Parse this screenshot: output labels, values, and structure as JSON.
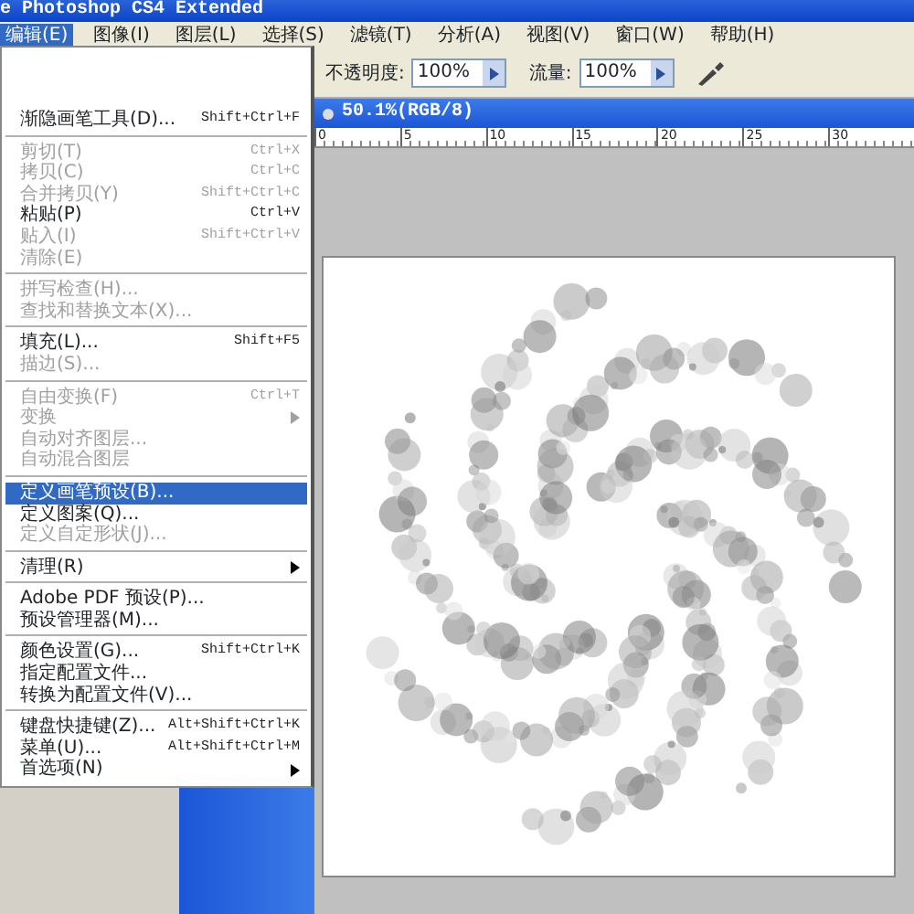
{
  "window": {
    "title": "e Photoshop CS4 Extended"
  },
  "menu_bar": [
    {
      "label": "编辑(E)",
      "selected": true
    },
    {
      "label": "图像(I)",
      "selected": false
    },
    {
      "label": "图层(L)",
      "selected": false
    },
    {
      "label": "选择(S)",
      "selected": false
    },
    {
      "label": "滤镜(T)",
      "selected": false
    },
    {
      "label": "分析(A)",
      "selected": false
    },
    {
      "label": "视图(V)",
      "selected": false
    },
    {
      "label": "窗口(W)",
      "selected": false
    },
    {
      "label": "帮助(H)",
      "selected": false
    }
  ],
  "options_bar": {
    "opacity_label": "不透明度:",
    "opacity_value": "100%",
    "flow_label": "流量:",
    "flow_value": "100%"
  },
  "edit_menu": [
    {
      "kind": "item",
      "label": "渐隐画笔工具(D)...",
      "shortcut": "Shift+Ctrl+F",
      "disabled": false,
      "selected": false
    },
    {
      "kind": "separator"
    },
    {
      "kind": "item",
      "label": "剪切(T)",
      "shortcut": "Ctrl+X",
      "disabled": true,
      "selected": false
    },
    {
      "kind": "item",
      "label": "拷贝(C)",
      "shortcut": "Ctrl+C",
      "disabled": true,
      "selected": false
    },
    {
      "kind": "item",
      "label": "合并拷贝(Y)",
      "shortcut": "Shift+Ctrl+C",
      "disabled": true,
      "selected": false
    },
    {
      "kind": "item",
      "label": "粘贴(P)",
      "shortcut": "Ctrl+V",
      "disabled": false,
      "selected": false
    },
    {
      "kind": "item",
      "label": "贴入(I)",
      "shortcut": "Shift+Ctrl+V",
      "disabled": true,
      "selected": false
    },
    {
      "kind": "item",
      "label": "清除(E)",
      "disabled": true,
      "selected": false
    },
    {
      "kind": "separator"
    },
    {
      "kind": "item",
      "label": "拼写检查(H)...",
      "disabled": true,
      "selected": false
    },
    {
      "kind": "item",
      "label": "查找和替换文本(X)...",
      "disabled": true,
      "selected": false
    },
    {
      "kind": "separator"
    },
    {
      "kind": "item",
      "label": "填充(L)...",
      "shortcut": "Shift+F5",
      "disabled": false,
      "selected": false
    },
    {
      "kind": "item",
      "label": "描边(S)...",
      "disabled": true,
      "selected": false
    },
    {
      "kind": "separator"
    },
    {
      "kind": "item",
      "label": "自由变换(F)",
      "shortcut": "Ctrl+T",
      "disabled": true,
      "selected": false
    },
    {
      "kind": "submenu",
      "label": "变换",
      "disabled": true,
      "selected": false
    },
    {
      "kind": "item",
      "label": "自动对齐图层...",
      "disabled": true,
      "selected": false
    },
    {
      "kind": "item",
      "label": "自动混合图层",
      "disabled": true,
      "selected": false
    },
    {
      "kind": "separator"
    },
    {
      "kind": "item",
      "label": "定义画笔预设(B)...",
      "disabled": false,
      "selected": true
    },
    {
      "kind": "item",
      "label": "定义图案(Q)...",
      "disabled": false,
      "selected": false
    },
    {
      "kind": "item",
      "label": "定义自定形状(J)...",
      "disabled": true,
      "selected": false
    },
    {
      "kind": "separator"
    },
    {
      "kind": "submenu",
      "label": "清理(R)",
      "disabled": false,
      "selected": false
    },
    {
      "kind": "separator"
    },
    {
      "kind": "item",
      "label": "Adobe PDF 预设(P)...",
      "disabled": false,
      "selected": false
    },
    {
      "kind": "item",
      "label": "预设管理器(M)...",
      "disabled": false,
      "selected": false
    },
    {
      "kind": "separator"
    },
    {
      "kind": "item",
      "label": "颜色设置(G)...",
      "shortcut": "Shift+Ctrl+K",
      "disabled": false,
      "selected": false
    },
    {
      "kind": "item",
      "label": "指定配置文件...",
      "disabled": false,
      "selected": false
    },
    {
      "kind": "item",
      "label": "转换为配置文件(V)...",
      "disabled": false,
      "selected": false
    },
    {
      "kind": "separator"
    },
    {
      "kind": "item",
      "label": "键盘快捷键(Z)...",
      "shortcut": "Alt+Shift+Ctrl+K",
      "disabled": false,
      "selected": false
    },
    {
      "kind": "item",
      "label": "菜单(U)...",
      "shortcut": "Alt+Shift+Ctrl+M",
      "disabled": false,
      "selected": false
    },
    {
      "kind": "submenu",
      "label": "首选项(N)",
      "disabled": false,
      "selected": false
    }
  ],
  "document": {
    "title": "50.1%(RGB/8)",
    "ruler_labels": [
      "0",
      "5",
      "10",
      "15",
      "20",
      "25",
      "30"
    ]
  }
}
